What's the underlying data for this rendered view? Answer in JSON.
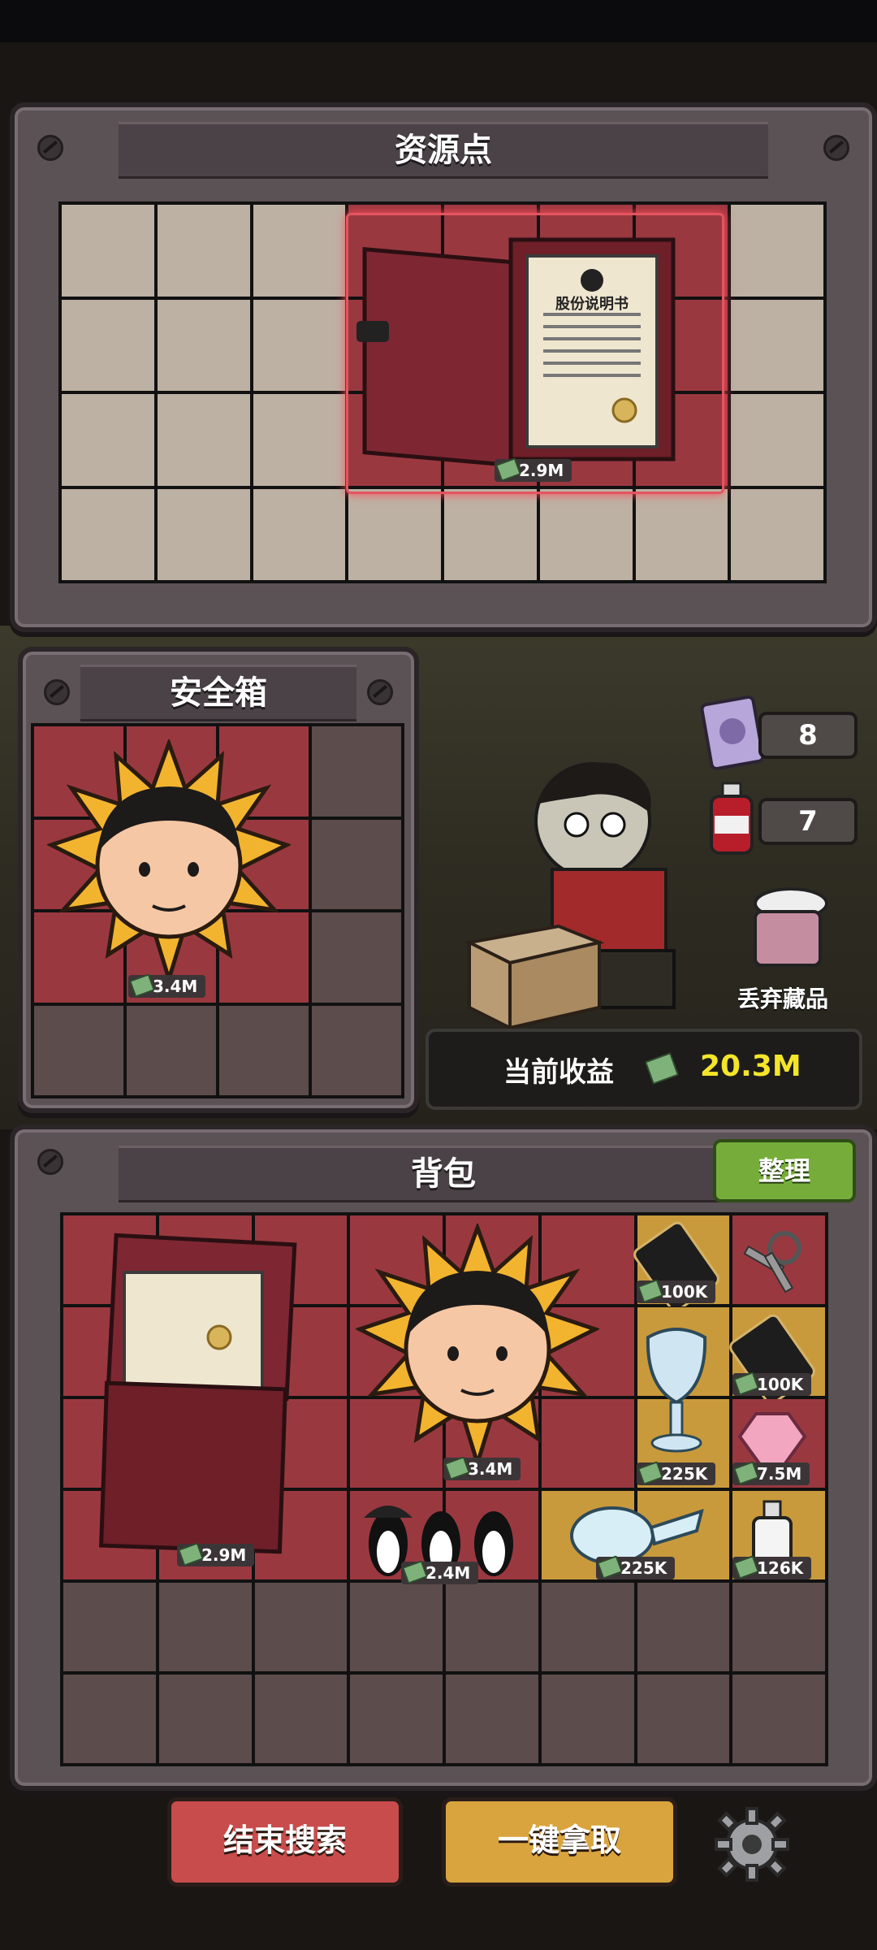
{
  "resource_panel": {
    "title": "资源点",
    "item_price": "2.9M"
  },
  "scene": {
    "counter_1": "8",
    "counter_2": "7",
    "discard_label": "丢弃藏品",
    "income_label": "当前收益",
    "income_value": "20.3M"
  },
  "safebox_panel": {
    "title": "安全箱",
    "item_price": "3.4M"
  },
  "backpack_panel": {
    "title": "背包",
    "organize_button": "整理",
    "item_prices": [
      "2.9M",
      "3.4M",
      "2.4M",
      "100K",
      "100K",
      "225K",
      "7.5M",
      "225K",
      "126K"
    ]
  },
  "doc_title": "股份说明书",
  "buttons": {
    "end_search": "结束搜索",
    "take_all": "一键拿取"
  },
  "colors": {
    "red_cell": "#9a3840",
    "gold_cell": "#c99a3c",
    "empty_cell": "#bdb1a3",
    "income_value": "#f4e52a"
  }
}
